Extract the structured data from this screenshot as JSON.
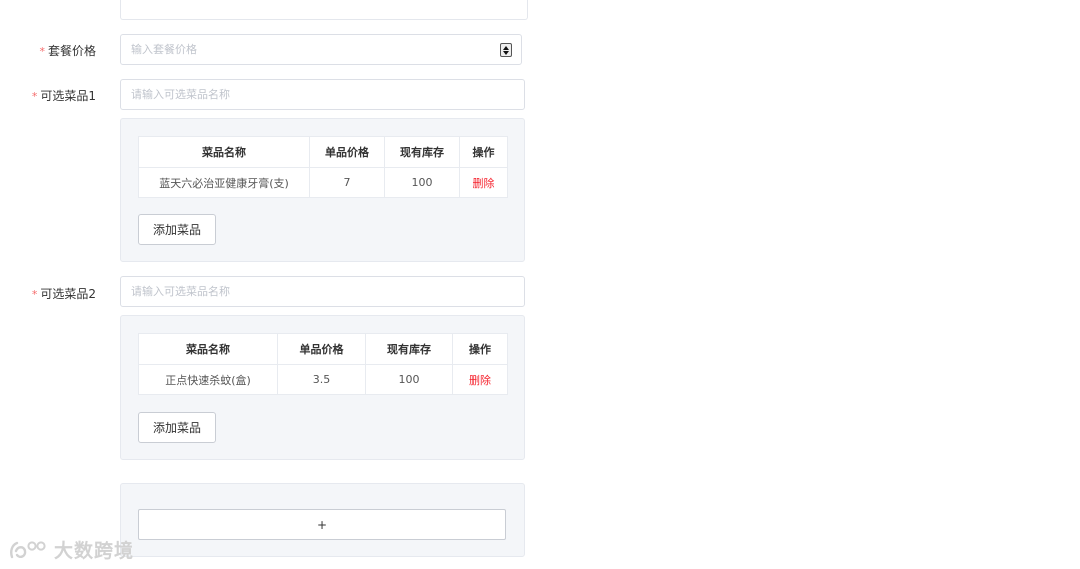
{
  "form": {
    "price_field": {
      "label": "套餐价格",
      "placeholder": "输入套餐价格",
      "value": ""
    },
    "optional_groups": [
      {
        "label": "可选菜品1",
        "placeholder": "请输入可选菜品名称",
        "value": "",
        "table": {
          "headers": [
            "菜品名称",
            "单品价格",
            "现有库存",
            "操作"
          ],
          "rows": [
            {
              "name": "蓝天六必治亚健康牙膏(支)",
              "price": "7",
              "stock": "100",
              "action": "删除"
            }
          ]
        },
        "add_label": "添加菜品"
      },
      {
        "label": "可选菜品2",
        "placeholder": "请输入可选菜品名称",
        "value": "",
        "table": {
          "headers": [
            "菜品名称",
            "单品价格",
            "现有库存",
            "操作"
          ],
          "rows": [
            {
              "name": "正点快速杀蚊(盒)",
              "price": "3.5",
              "stock": "100",
              "action": "删除"
            }
          ]
        },
        "add_label": "添加菜品"
      }
    ],
    "add_group_label": "+"
  },
  "watermark": {
    "text": "大数跨境",
    "icon": "brand-logo-icon"
  },
  "colors": {
    "required_star": "#f56c6c",
    "delete_text": "#f5222d",
    "panel_bg": "#f4f6f9",
    "border": "#dcdfe6"
  }
}
